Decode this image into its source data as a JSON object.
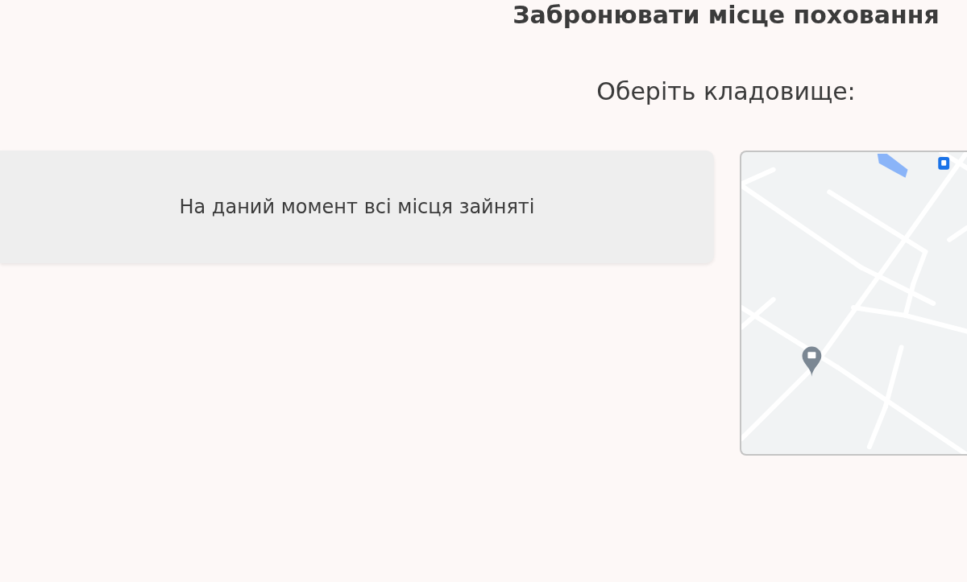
{
  "page": {
    "title": "Забронювати місце поховання",
    "subtitle": "Оберіть кладовище:"
  },
  "notice": {
    "text": "На даний момент всі місця зайняті"
  }
}
